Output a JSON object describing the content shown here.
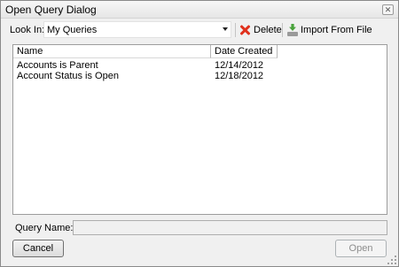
{
  "window": {
    "title": "Open Query Dialog",
    "close_glyph": "✕"
  },
  "toolbar": {
    "look_in_label": "Look In:",
    "look_in_value": "My Queries",
    "delete_label": "Delete",
    "import_label": "Import From File"
  },
  "list": {
    "columns": [
      "Name",
      "Date Created"
    ],
    "rows": [
      {
        "name": "Accounts is Parent",
        "date": "12/14/2012"
      },
      {
        "name": "Account Status is Open",
        "date": "12/18/2012"
      }
    ]
  },
  "query_name": {
    "label": "Query Name:",
    "value": ""
  },
  "buttons": {
    "cancel": "Cancel",
    "open": "Open"
  },
  "icons": {
    "delete": "red-x-icon",
    "import": "green-arrow-import-icon",
    "dropdown": "chevron-down-icon"
  }
}
